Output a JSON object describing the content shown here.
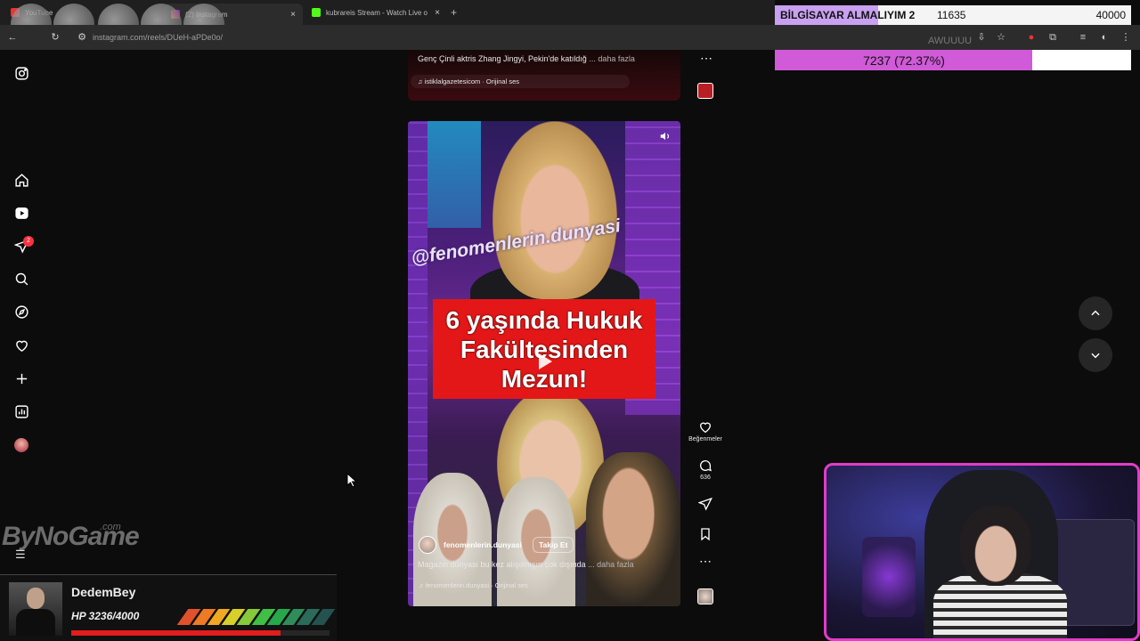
{
  "browser": {
    "tabs": [
      {
        "label": "YouTube",
        "active": false
      },
      {
        "label": "(2) Instagram",
        "active": true
      },
      {
        "label": "kubrareis Stream - Watch Live o",
        "active": false
      }
    ],
    "url": "instagram.com/reels/DUeH-aPDe0o/",
    "close_glyph": "×",
    "new_tab_glyph": "+"
  },
  "donation": {
    "title": "BİLGİSAYAR ALMALIYIM 2",
    "current": "11635",
    "goal": "40000",
    "fraction": 0.29,
    "color": "#c9a1f1"
  },
  "overlay_text": {
    "awuu": "AWUUUU"
  },
  "progress": {
    "text": "7237 (72.37%)",
    "fraction": 0.7237,
    "color": "#d05ad8"
  },
  "sidebar": {
    "items": [
      {
        "name": "instagram-logo-icon"
      },
      {
        "name": "home-icon"
      },
      {
        "name": "reels-icon"
      },
      {
        "name": "messages-icon",
        "badge": "2"
      },
      {
        "name": "search-icon"
      },
      {
        "name": "explore-icon"
      },
      {
        "name": "notifications-icon"
      },
      {
        "name": "create-icon"
      },
      {
        "name": "dashboard-icon"
      },
      {
        "name": "profile-avatar"
      }
    ]
  },
  "post_prev": {
    "caption": "Genç Çinli aktris Zhang Jingyi, Pekin'de katıldığ",
    "more": " ... daha fazla",
    "audio": "istiklalgazetesicom · Orijinal ses"
  },
  "reel": {
    "watermark": "@fenomenlerin.dunyasi",
    "banner": [
      "6 yaşında Hukuk",
      "Fakültesinden",
      "Mezun!"
    ],
    "username": "fenomenlerin.dunyasi",
    "follow_label": "Takip Et",
    "caption": "Magazin dünyası bu kez alışılmışın çok dışında",
    "more": " ... daha fazla",
    "audio": "fenomenlerin.dunyasi · Orijinal ses",
    "like_label": "Beğenmeler",
    "comment_count": "636"
  },
  "overlay": {
    "logo": "ByNoGame",
    "logo_tld": ".com",
    "hp_name": "DedemBey",
    "hp_value": "HP 3236/4000",
    "hp_fraction": 0.809,
    "hp_segments": [
      "#e0522b",
      "#ee7a24",
      "#f0a823",
      "#d7cf2a",
      "#86c93a",
      "#3fbf45",
      "#27a84a",
      "#2e8d5a",
      "#2a6b5a",
      "#24524f"
    ]
  },
  "colors": {
    "accent_pink": "#e23cc8",
    "badge_red": "#ff3040",
    "banner_red": "#e31717"
  }
}
